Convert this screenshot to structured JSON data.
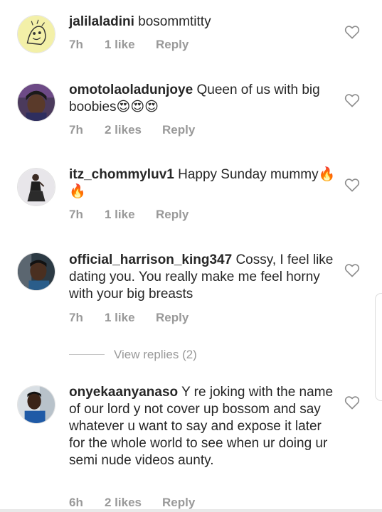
{
  "comments": [
    {
      "username": "jalilaladini",
      "text": "bosommtitty",
      "time": "7h",
      "likes": "1 like",
      "reply": "Reply",
      "avatar": "avatar-sketch-icon"
    },
    {
      "username": "omotolaoladunjoye",
      "text": "Queen of us with big boobies😍😍😍",
      "time": "7h",
      "likes": "2 likes",
      "reply": "Reply",
      "avatar": "avatar-photo-woman"
    },
    {
      "username": "itz_chommyluv1",
      "text": "Happy Sunday mummy🔥🔥",
      "time": "7h",
      "likes": "1 like",
      "reply": "Reply",
      "avatar": "avatar-photo-woman-standing"
    },
    {
      "username": "official_harrison_king347",
      "text": "Cossy, I feel like dating you. You really make me feel horny with your big breasts",
      "time": "7h",
      "likes": "1 like",
      "reply": "Reply",
      "avatar": "avatar-photo-man"
    },
    {
      "username": "onyekaanyanaso",
      "text": "Y re joking with the name of  our lord y not cover up bossom and say whatever u want to say and expose it later for the whole world to see when ur doing ur semi nude videos aunty.",
      "time": "6h",
      "likes": "2 likes",
      "reply": "Reply",
      "avatar": "avatar-photo-man-blue"
    }
  ],
  "view_replies": "View replies (2)",
  "icons": {
    "like": "heart-outline-icon"
  },
  "colors": {
    "text": "#262626",
    "meta": "#999999"
  }
}
